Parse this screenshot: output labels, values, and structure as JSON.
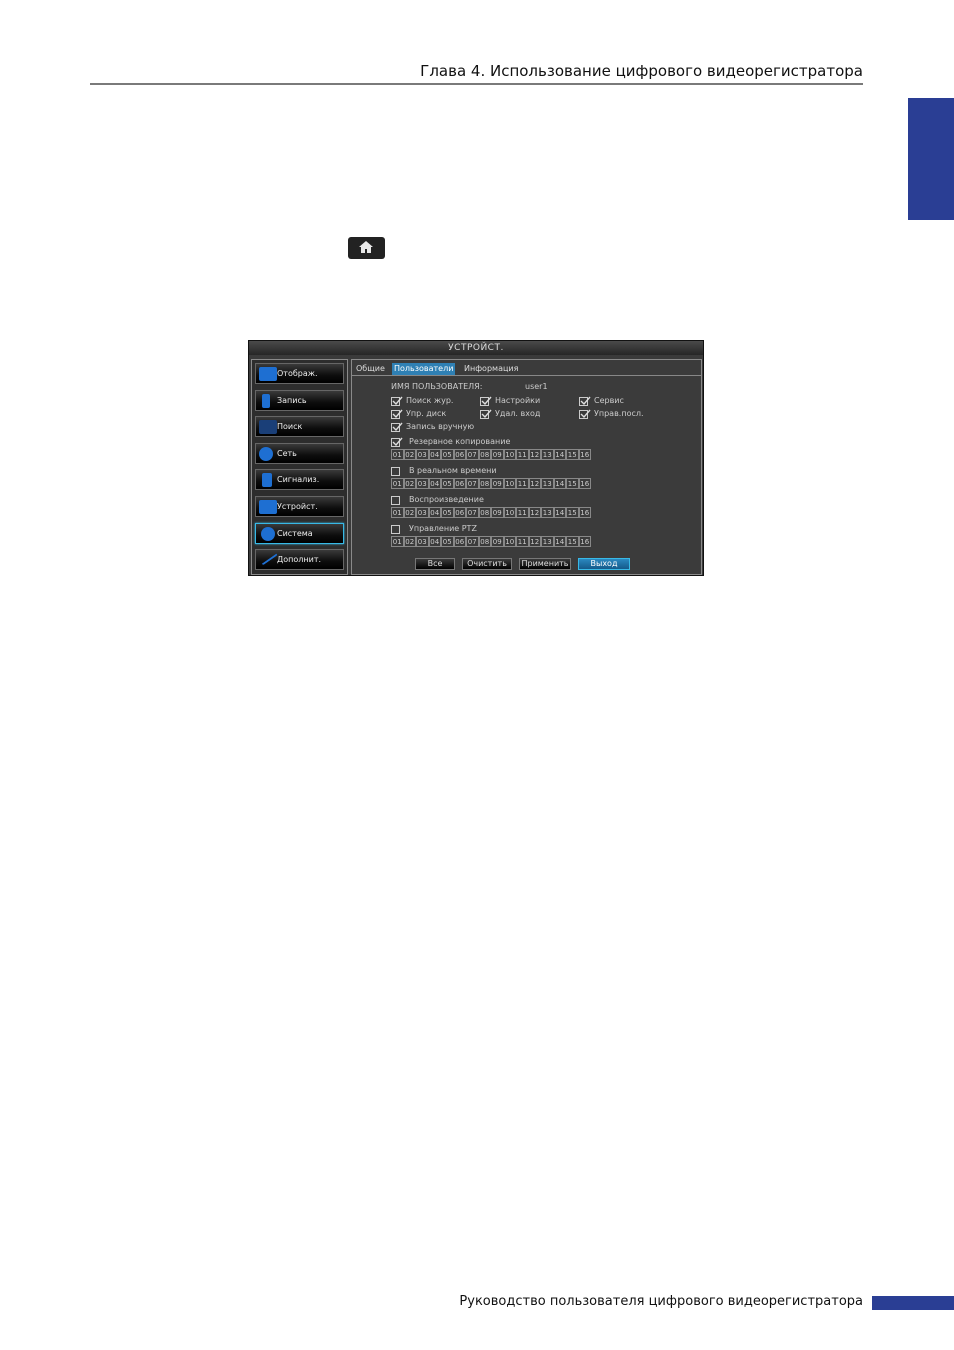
{
  "header": {
    "chapter_title": "Глава 4. Использование цифрового видеорегистратора"
  },
  "footer": {
    "manual_title": "Руководство пользователя цифрового видеорегистратора"
  },
  "accent_color": "#2a3e94",
  "home_icon": "home-icon",
  "dvr": {
    "title": "УСТРОЙСТ.",
    "menu": [
      {
        "label": "Отображ.",
        "icon": "monitor-icon"
      },
      {
        "label": "Запись",
        "icon": "record-icon"
      },
      {
        "label": "Поиск",
        "icon": "search-icon"
      },
      {
        "label": "Сеть",
        "icon": "network-icon"
      },
      {
        "label": "Сигнализ.",
        "icon": "alarm-icon"
      },
      {
        "label": "Устройст.",
        "icon": "device-icon"
      },
      {
        "label": "Система",
        "icon": "gear-icon"
      },
      {
        "label": "Дополнит.",
        "icon": "tools-icon"
      }
    ],
    "active_menu": "Система",
    "tabs": [
      "Общие",
      "Пользователи",
      "Информация"
    ],
    "active_tab": "Пользователи",
    "username_label": "ИМЯ ПОЛЬЗОВАТЕЛЯ:",
    "username_value": "user1",
    "permissions": {
      "log_search": {
        "label": "Поиск жур.",
        "checked": true
      },
      "settings": {
        "label": "Настройки",
        "checked": true
      },
      "service": {
        "label": "Сервис",
        "checked": true
      },
      "disk_mgmt": {
        "label": "Упр. диск",
        "checked": true
      },
      "remote_login": {
        "label": "Удал. вход",
        "checked": true
      },
      "serial_control": {
        "label": "Управ.посл.",
        "checked": true
      },
      "manual_record": {
        "label": "Запись вручную",
        "checked": true
      }
    },
    "channel_groups": {
      "backup": {
        "label": "Резервное копирование",
        "checked": true
      },
      "live": {
        "label": "В реальном времени",
        "checked": false
      },
      "playback": {
        "label": "Воспроизведение",
        "checked": false
      },
      "ptz": {
        "label": "Управление PTZ",
        "checked": false
      }
    },
    "channels": [
      "01",
      "02",
      "03",
      "04",
      "05",
      "06",
      "07",
      "08",
      "09",
      "10",
      "11",
      "12",
      "13",
      "14",
      "15",
      "16"
    ],
    "buttons": {
      "all": "Все",
      "clear": "Очистить",
      "apply": "Применить",
      "exit": "Выход"
    }
  }
}
